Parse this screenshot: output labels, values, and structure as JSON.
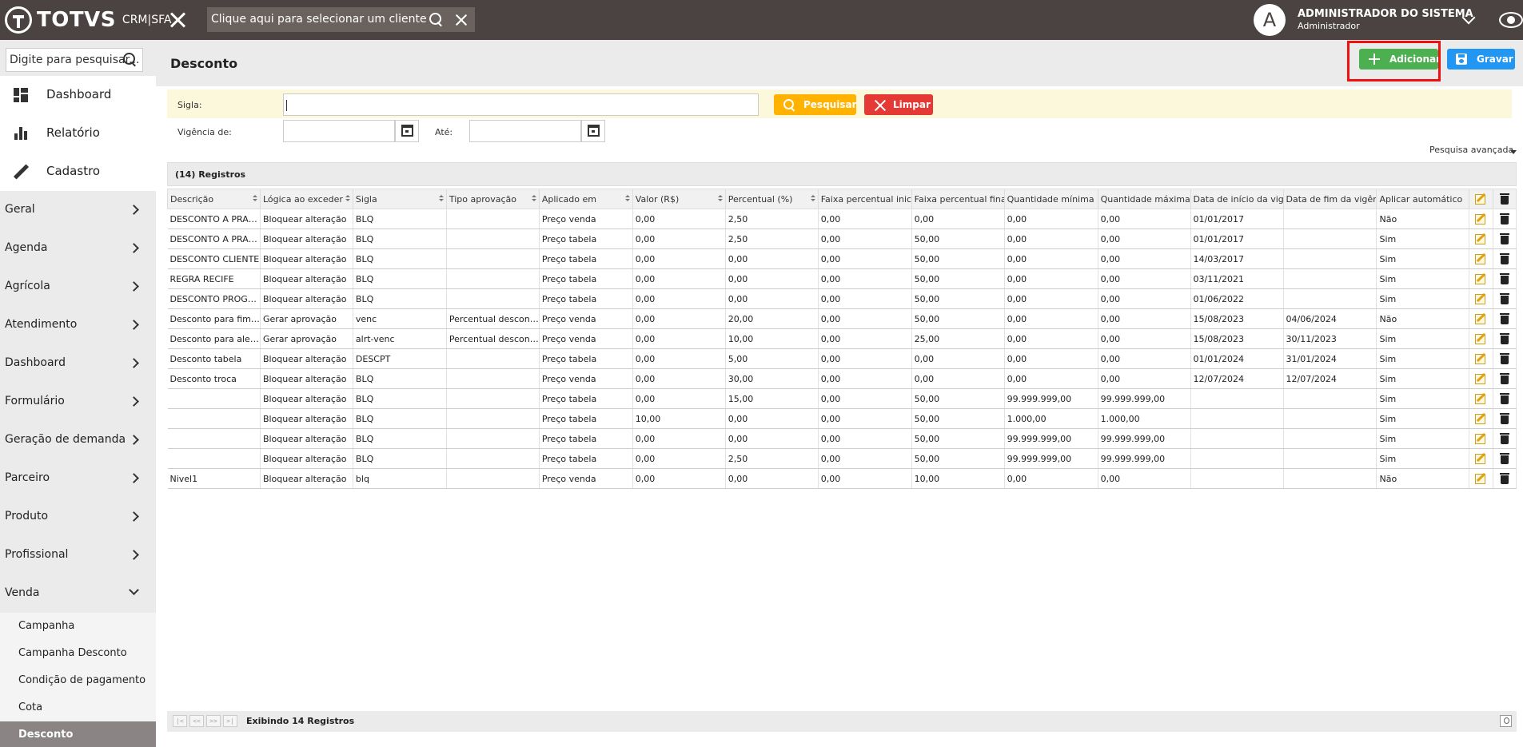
{
  "topbar": {
    "logo_text": "TOTVS",
    "logo_sub": "CRM|SFA",
    "client_placeholder": "Clique aqui para selecionar um cliente",
    "avatar_letter": "A",
    "user_name": "ADMINISTRADOR DO SISTEMA",
    "user_role": "Administrador"
  },
  "sidebar": {
    "search_placeholder": "Digite para pesquisar...",
    "top_items": [
      {
        "label": "Dashboard",
        "icon": "dashboard-icon"
      },
      {
        "label": "Relatório",
        "icon": "bar-chart-icon"
      },
      {
        "label": "Cadastro",
        "icon": "pencil-icon"
      }
    ],
    "groups": [
      {
        "label": "Geral"
      },
      {
        "label": "Agenda"
      },
      {
        "label": "Agrícola"
      },
      {
        "label": "Atendimento"
      },
      {
        "label": "Dashboard"
      },
      {
        "label": "Formulário"
      },
      {
        "label": "Geração de demanda"
      },
      {
        "label": "Parceiro"
      },
      {
        "label": "Produto"
      },
      {
        "label": "Profissional"
      },
      {
        "label": "Venda"
      }
    ],
    "venda_items": [
      {
        "label": "Campanha"
      },
      {
        "label": "Campanha Desconto"
      },
      {
        "label": "Condição de pagamento"
      },
      {
        "label": "Cota"
      },
      {
        "label": "Desconto"
      }
    ]
  },
  "page": {
    "title": "Desconto",
    "add_label": "Adicionar",
    "save_label": "Gravar"
  },
  "filters": {
    "sigla_label": "Sigla:",
    "vigencia_label": "Vigência de:",
    "ate_label": "Até:",
    "search_label": "Pesquisar",
    "clear_label": "Limpar",
    "advanced_label": "Pesquisa avançada"
  },
  "grid": {
    "count_label": "(14) Registros",
    "columns": [
      "Descrição",
      "Lógica ao exceder",
      "Sigla",
      "Tipo aprovação",
      "Aplicado em",
      "Valor (R$)",
      "Percentual (%)",
      "Faixa percentual inicial",
      "Faixa percentual final",
      "Quantidade mínima",
      "Quantidade máxima",
      "Data de início da vigência",
      "Data de fim da vigência",
      "Aplicar automático"
    ],
    "rows": [
      [
        "DESCONTO A PRAZO",
        "Bloquear alteração",
        "BLQ",
        "",
        "Preço venda",
        "0,00",
        "2,50",
        "0,00",
        "0,00",
        "0,00",
        "0,00",
        "01/01/2017",
        "",
        "Não"
      ],
      [
        "DESCONTO A PRAZO",
        "Bloquear alteração",
        "BLQ",
        "",
        "Preço tabela",
        "0,00",
        "2,50",
        "0,00",
        "50,00",
        "0,00",
        "0,00",
        "01/01/2017",
        "",
        "Sim"
      ],
      [
        "DESCONTO CLIENTE",
        "Bloquear alteração",
        "BLQ",
        "",
        "Preço tabela",
        "0,00",
        "0,00",
        "0,00",
        "50,00",
        "0,00",
        "0,00",
        "14/03/2017",
        "",
        "Sim"
      ],
      [
        "REGRA RECIFE",
        "Bloquear alteração",
        "BLQ",
        "",
        "Preço tabela",
        "0,00",
        "0,00",
        "0,00",
        "50,00",
        "0,00",
        "0,00",
        "03/11/2021",
        "",
        "Sim"
      ],
      [
        "DESCONTO PROGRESSIVO",
        "Bloquear alteração",
        "BLQ",
        "",
        "Preço tabela",
        "0,00",
        "0,00",
        "0,00",
        "50,00",
        "0,00",
        "0,00",
        "01/06/2022",
        "",
        "Sim"
      ],
      [
        "Desconto para fim vigência",
        "Gerar aprovação",
        "venc",
        "Percentual desconto excedido",
        "Preço venda",
        "0,00",
        "20,00",
        "0,00",
        "50,00",
        "0,00",
        "0,00",
        "15/08/2023",
        "04/06/2024",
        "Não"
      ],
      [
        "Desconto para alerta vencimento",
        "Gerar aprovação",
        "alrt-venc",
        "Percentual desconto excedido",
        "Preço venda",
        "0,00",
        "10,00",
        "0,00",
        "25,00",
        "0,00",
        "0,00",
        "15/08/2023",
        "30/11/2023",
        "Sim"
      ],
      [
        "Desconto tabela",
        "Bloquear alteração",
        "DESCPT",
        "",
        "Preço tabela",
        "0,00",
        "5,00",
        "0,00",
        "0,00",
        "0,00",
        "0,00",
        "01/01/2024",
        "31/01/2024",
        "Sim"
      ],
      [
        "Desconto troca",
        "Bloquear alteração",
        "BLQ",
        "",
        "Preço venda",
        "0,00",
        "30,00",
        "0,00",
        "0,00",
        "0,00",
        "0,00",
        "12/07/2024",
        "12/07/2024",
        "Sim"
      ],
      [
        "",
        "Bloquear alteração",
        "BLQ",
        "",
        "Preço tabela",
        "0,00",
        "15,00",
        "0,00",
        "50,00",
        "99.999.999,00",
        "99.999.999,00",
        "",
        "",
        "Sim"
      ],
      [
        "",
        "Bloquear alteração",
        "BLQ",
        "",
        "Preço tabela",
        "10,00",
        "0,00",
        "0,00",
        "50,00",
        "1.000,00",
        "1.000,00",
        "",
        "",
        "Sim"
      ],
      [
        "",
        "Bloquear alteração",
        "BLQ",
        "",
        "Preço tabela",
        "0,00",
        "0,00",
        "0,00",
        "50,00",
        "99.999.999,00",
        "99.999.999,00",
        "",
        "",
        "Sim"
      ],
      [
        "",
        "Bloquear alteração",
        "BLQ",
        "",
        "Preço tabela",
        "0,00",
        "2,50",
        "0,00",
        "50,00",
        "99.999.999,00",
        "99.999.999,00",
        "",
        "",
        "Sim"
      ],
      [
        "Nivel1",
        "Bloquear alteração",
        "blq",
        "",
        "Preço venda",
        "0,00",
        "0,00",
        "0,00",
        "10,00",
        "0,00",
        "0,00",
        "",
        "",
        "Não"
      ]
    ],
    "footer_label": "Exibindo 14 Registros"
  },
  "colors": {
    "topbar": "#4a4341",
    "add": "#4caf50",
    "save": "#2196f3",
    "search": "#ffb300",
    "clear": "#e53935",
    "highlight": "#e11111"
  }
}
